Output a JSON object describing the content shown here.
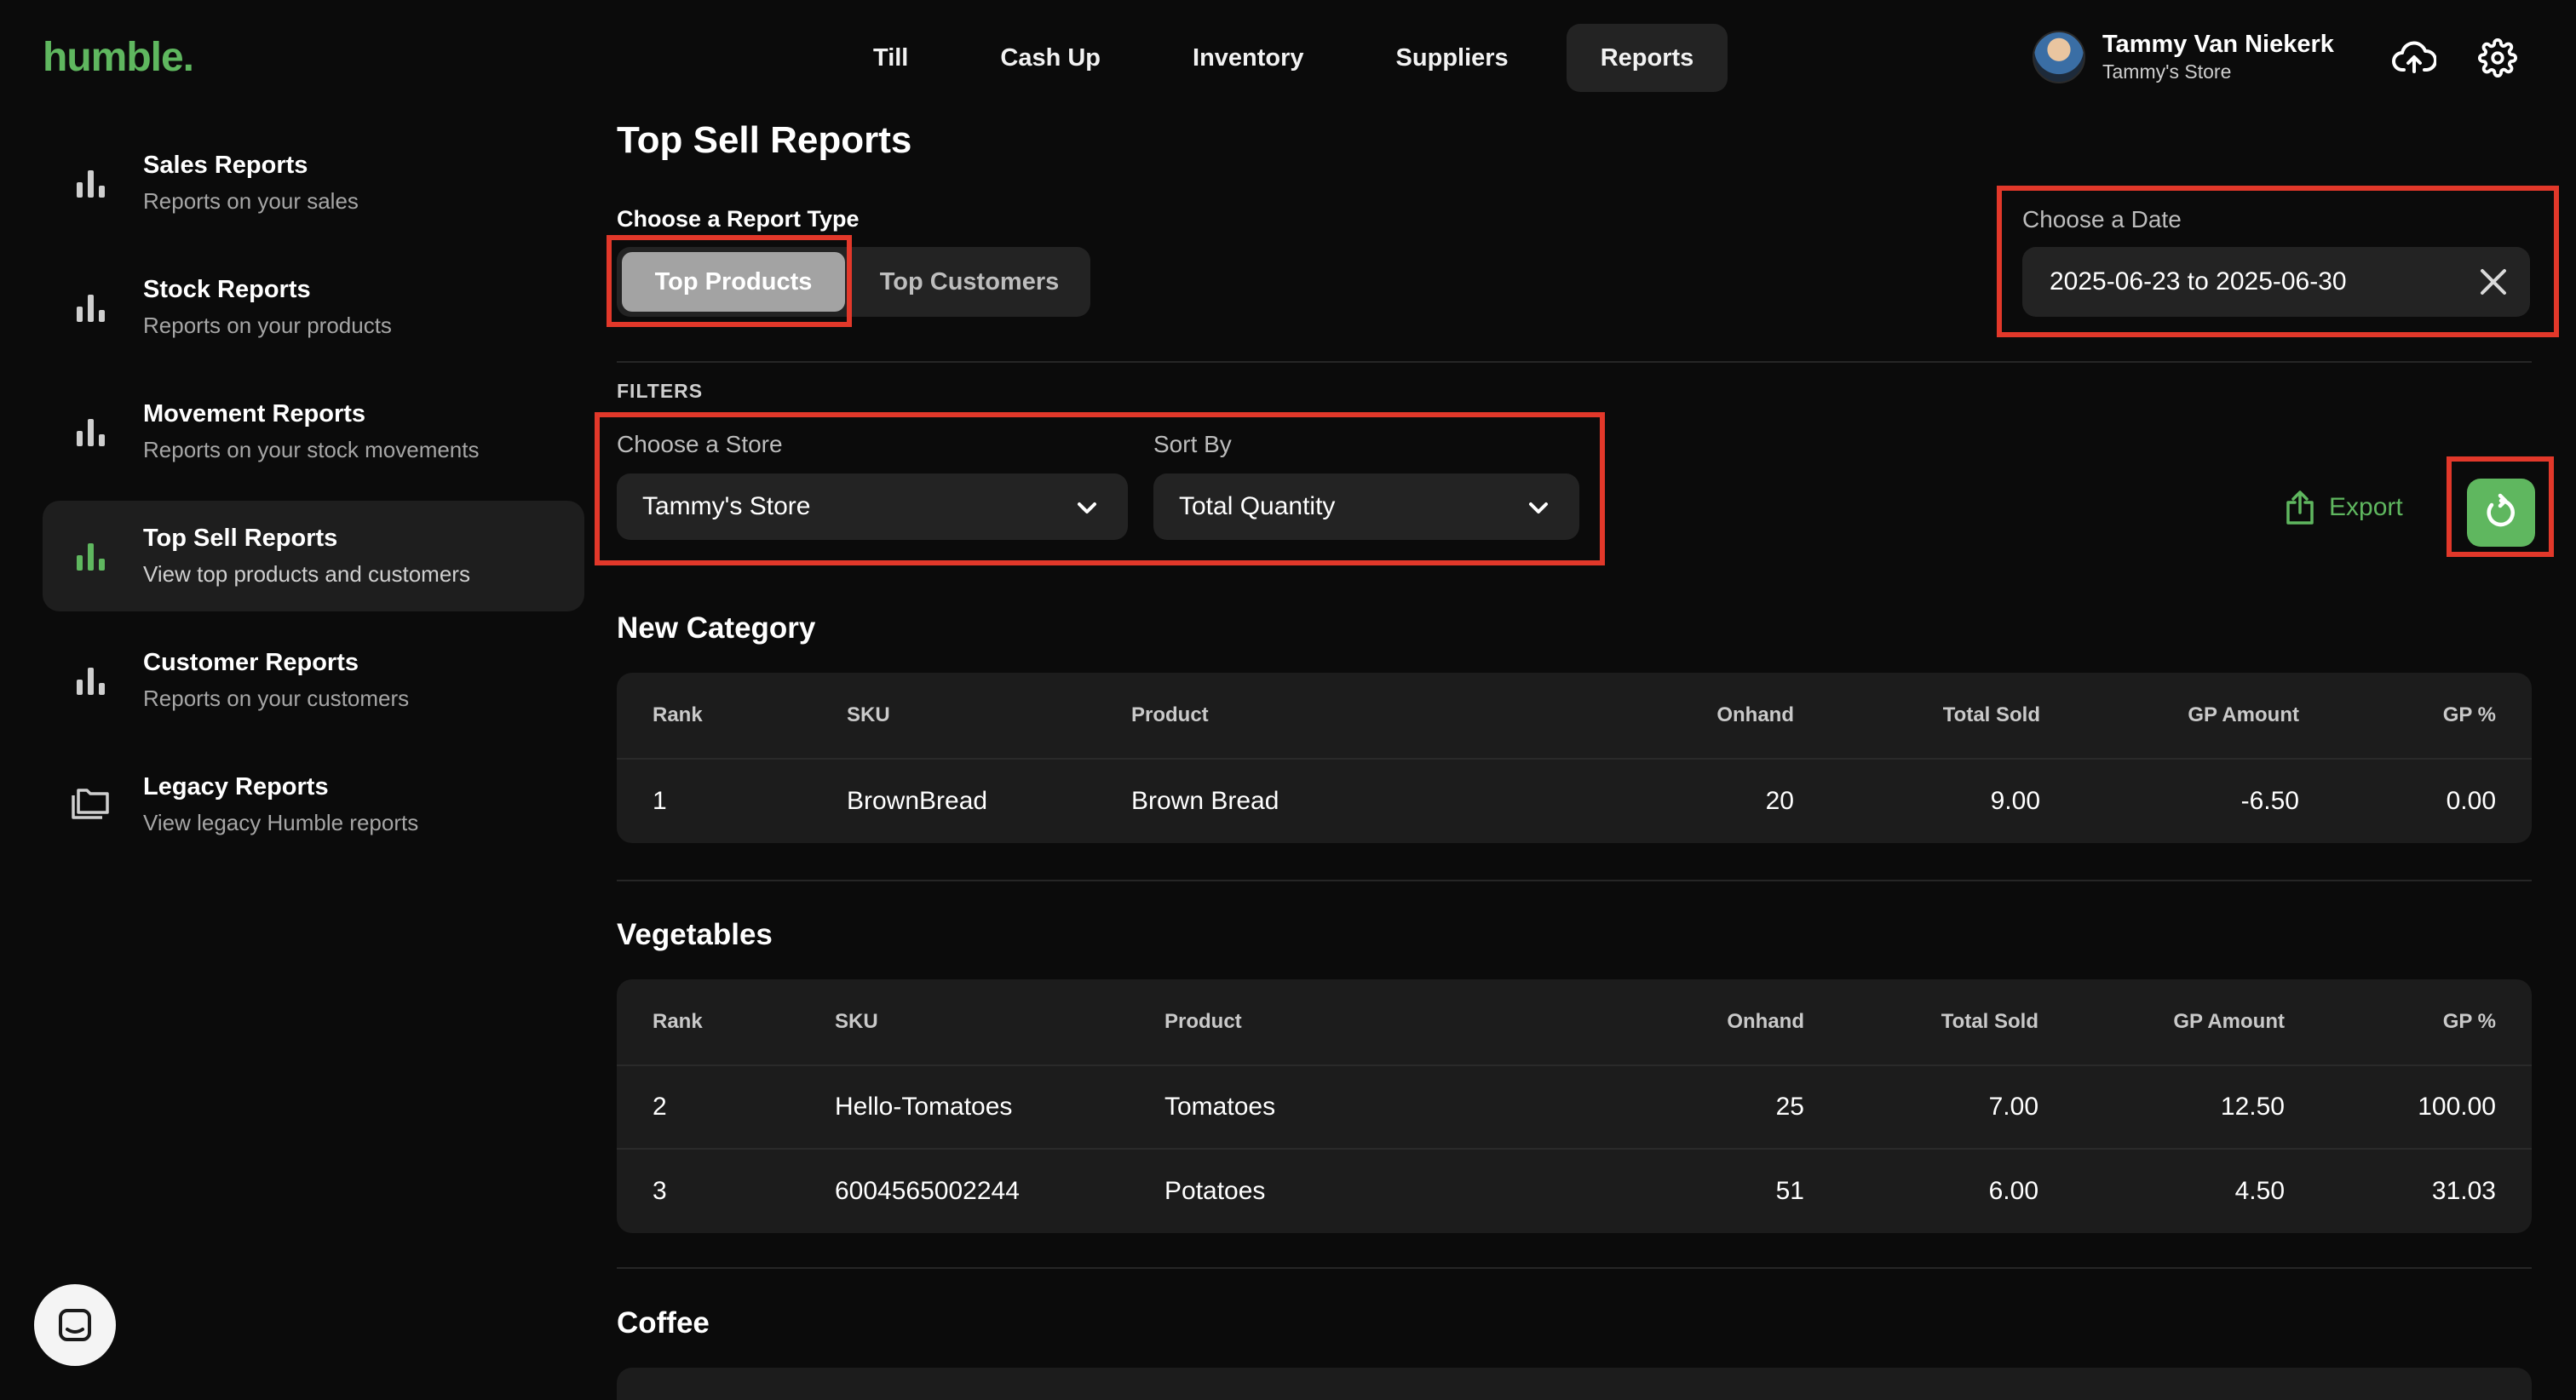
{
  "brand": {
    "logo": "humble.",
    "accent": "#5fb75f"
  },
  "topnav": [
    {
      "label": "Till",
      "active": false
    },
    {
      "label": "Cash Up",
      "active": false
    },
    {
      "label": "Inventory",
      "active": false
    },
    {
      "label": "Suppliers",
      "active": false
    },
    {
      "label": "Reports",
      "active": true
    }
  ],
  "user": {
    "name": "Tammy Van Niekerk",
    "store": "Tammy's Store"
  },
  "sidebar": [
    {
      "title": "Sales Reports",
      "subtitle": "Reports on your sales",
      "icon": "bar-chart-icon",
      "active": false
    },
    {
      "title": "Stock Reports",
      "subtitle": "Reports on your products",
      "icon": "bar-chart-icon",
      "active": false
    },
    {
      "title": "Movement Reports",
      "subtitle": "Reports on your stock movements",
      "icon": "bar-chart-icon",
      "active": false
    },
    {
      "title": "Top Sell Reports",
      "subtitle": "View top products and customers",
      "icon": "bar-chart-icon",
      "active": true
    },
    {
      "title": "Customer Reports",
      "subtitle": "Reports on your customers",
      "icon": "bar-chart-icon",
      "active": false
    },
    {
      "title": "Legacy Reports",
      "subtitle": "View legacy Humble reports",
      "icon": "folders-icon",
      "active": false
    }
  ],
  "page": {
    "title": "Top Sell Reports",
    "report_type_label": "Choose a Report Type",
    "report_types": [
      "Top Products",
      "Top Customers"
    ],
    "selected_report_type": "Top Products",
    "date_label": "Choose a Date",
    "date_value": "2025-06-23 to 2025-06-30",
    "filters_label": "FILTERS",
    "store_label": "Choose a Store",
    "store_value": "Tammy's Store",
    "sort_label": "Sort By",
    "sort_value": "Total Quantity",
    "export_label": "Export"
  },
  "columns": [
    "Rank",
    "SKU",
    "Product",
    "Onhand",
    "Total Sold",
    "GP Amount",
    "GP %"
  ],
  "categories": [
    {
      "name": "New Category",
      "rows": [
        {
          "rank": "1",
          "sku": "BrownBread",
          "product": "Brown Bread",
          "onhand": "20",
          "total_sold": "9.00",
          "gp_amount": "-6.50",
          "gp_pct": "0.00"
        }
      ]
    },
    {
      "name": "Vegetables",
      "rows": [
        {
          "rank": "2",
          "sku": "Hello-Tomatoes",
          "product": "Tomatoes",
          "onhand": "25",
          "total_sold": "7.00",
          "gp_amount": "12.50",
          "gp_pct": "100.00"
        },
        {
          "rank": "3",
          "sku": "6004565002244",
          "product": "Potatoes",
          "onhand": "51",
          "total_sold": "6.00",
          "gp_amount": "4.50",
          "gp_pct": "31.03"
        }
      ]
    },
    {
      "name": "Coffee",
      "rows": []
    }
  ]
}
